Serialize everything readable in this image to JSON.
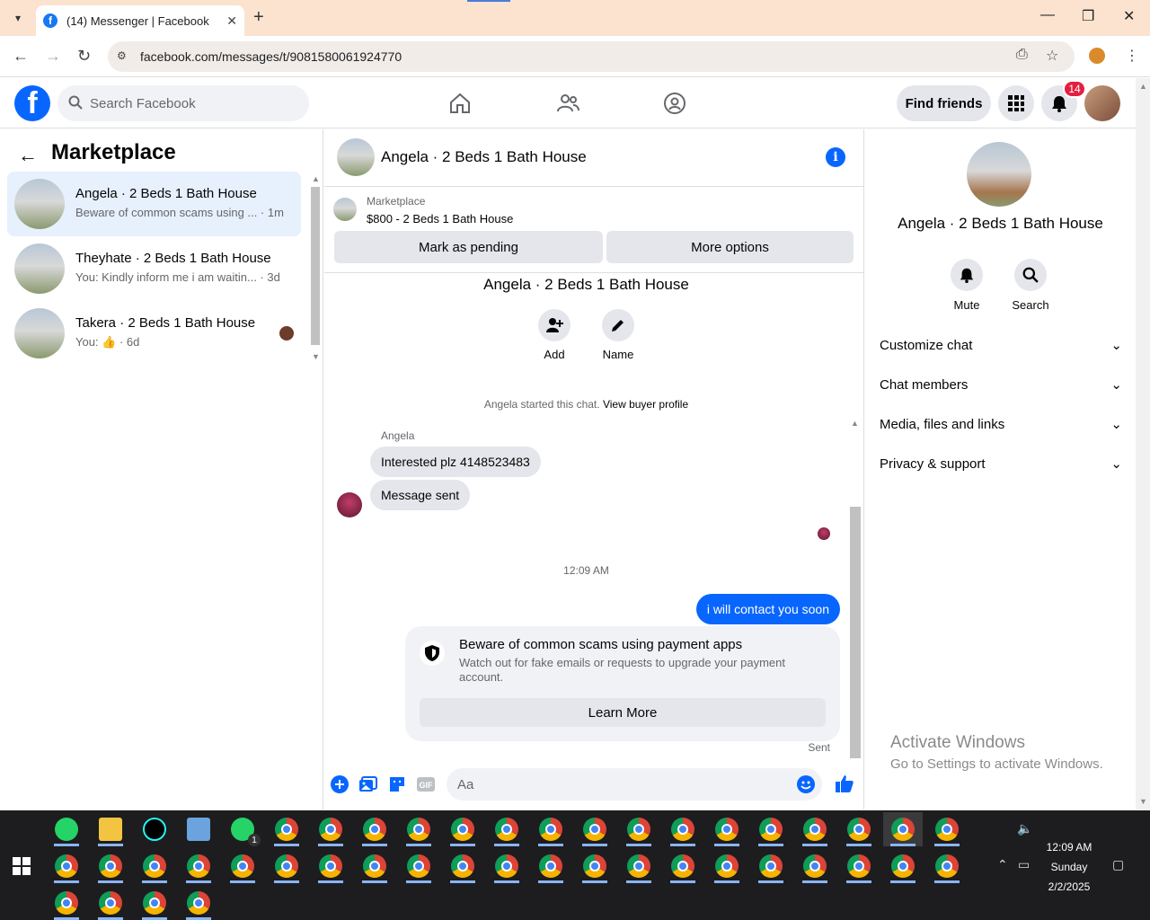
{
  "browser": {
    "tab_title": "(14) Messenger | Facebook",
    "url": "facebook.com/messages/t/9081580061924770"
  },
  "header": {
    "search_placeholder": "Search Facebook",
    "find_friends": "Find friends",
    "notification_count": "14"
  },
  "left": {
    "title": "Marketplace",
    "conversations": [
      {
        "name": "Angela · 2 Beds 1 Bath House",
        "preview": "Beware of common scams using ... · 1m",
        "active": true
      },
      {
        "name": "Theyhate · 2 Beds 1 Bath House",
        "preview": "You: Kindly inform me i am waitin... · 3d",
        "active": false
      },
      {
        "name": "Takera · 2 Beds 1 Bath House",
        "preview_prefix": "You:",
        "preview_suffix": " · 6d",
        "active": false
      }
    ]
  },
  "chat": {
    "title": "Angela · 2 Beds 1 Bath House",
    "marketplace_label": "Marketplace",
    "listing": "$800 - 2 Beds 1 Bath House",
    "mark_pending": "Mark as pending",
    "more_options": "More options",
    "thread_title": "Angela · 2 Beds 1 Bath House",
    "add_label": "Add",
    "name_label": "Name",
    "started_text": "Angela started this chat.",
    "view_buyer": "View buyer profile",
    "sender": "Angela",
    "msg1": "Interested plz 4148523483",
    "msg2": "Message sent",
    "time": "12:09 AM",
    "my_msg": "i will contact you soon",
    "scam_title": "Beware of common scams using payment apps",
    "scam_body": "Watch out for fake emails or requests to upgrade your payment account.",
    "learn_more": "Learn More",
    "sent": "Sent",
    "composer_placeholder": "Aa"
  },
  "right": {
    "name": "Angela · 2 Beds 1 Bath House",
    "mute": "Mute",
    "search": "Search",
    "sections": [
      "Customize chat",
      "Chat members",
      "Media, files and links",
      "Privacy & support"
    ],
    "activate_title": "Activate Windows",
    "activate_sub": "Go to Settings to activate Windows."
  },
  "taskbar": {
    "time": "12:09 AM",
    "day": "Sunday",
    "date": "2/2/2025",
    "whatsapp_badge": "1"
  },
  "colors": {
    "brand": "#0866ff",
    "badge": "#e41e3f"
  }
}
